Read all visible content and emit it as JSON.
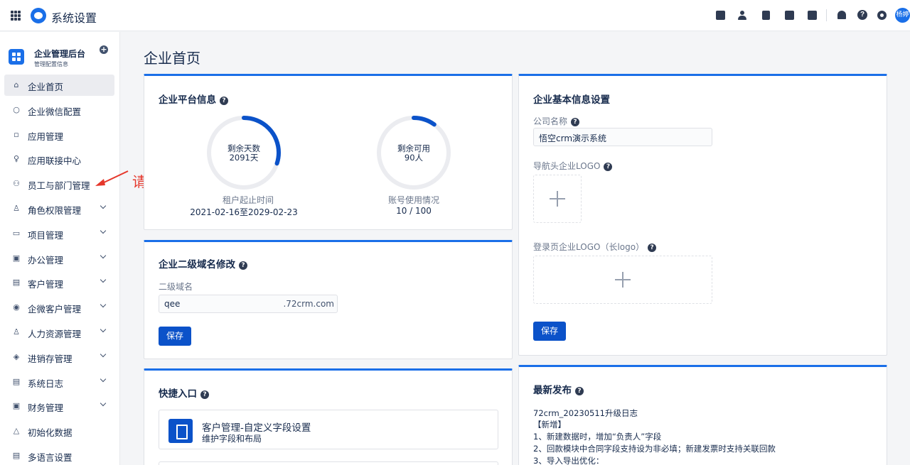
{
  "topbar": {
    "app_title": "系统设置",
    "icons": [
      "calendar-check-icon",
      "contacts-icon",
      "document-icon",
      "phone-icon",
      "calendar-icon",
      "bell-icon",
      "help-icon",
      "settings-icon"
    ],
    "avatar_text": "杨婷"
  },
  "sidebar": {
    "title": "企业管理后台",
    "subtitle": "管理配置信息",
    "items": [
      {
        "label": "企业首页",
        "icon": "home-icon",
        "expandable": false,
        "active": true
      },
      {
        "label": "企业微信配置",
        "icon": "search-icon",
        "expandable": false
      },
      {
        "label": "应用管理",
        "icon": "apps-icon",
        "expandable": false
      },
      {
        "label": "应用联接中心",
        "icon": "bulb-icon",
        "expandable": false
      },
      {
        "label": "员工与部门管理",
        "icon": "users-icon",
        "expandable": false
      },
      {
        "label": "角色权限管理",
        "icon": "role-icon",
        "expandable": true
      },
      {
        "label": "项目管理",
        "icon": "project-icon",
        "expandable": true
      },
      {
        "label": "办公管理",
        "icon": "office-icon",
        "expandable": true
      },
      {
        "label": "客户管理",
        "icon": "customer-icon",
        "expandable": true
      },
      {
        "label": "企微客户管理",
        "icon": "wecom-icon",
        "expandable": true
      },
      {
        "label": "人力资源管理",
        "icon": "hr-icon",
        "expandable": true
      },
      {
        "label": "进销存管理",
        "icon": "inventory-icon",
        "expandable": true
      },
      {
        "label": "系统日志",
        "icon": "log-icon",
        "expandable": true
      },
      {
        "label": "财务管理",
        "icon": "finance-icon",
        "expandable": true
      },
      {
        "label": "初始化数据",
        "icon": "init-icon",
        "expandable": false
      },
      {
        "label": "多语言设置",
        "icon": "language-icon",
        "expandable": false
      }
    ]
  },
  "annotation": {
    "text": "请单击此处",
    "color": "#e5372b"
  },
  "main": {
    "page_title": "企业首页",
    "platform": {
      "title": "企业平台信息",
      "days_label": "剩余天数",
      "days_value": "2091天",
      "days_fraction": 0.3,
      "period_caption": "租户起止时间",
      "period_value": "2021-02-16至2029-02-23",
      "accounts_label": "剩余可用",
      "accounts_value": "90人",
      "accounts_fraction": 0.1,
      "accounts_caption": "账号使用情况",
      "accounts_usage": "10 / 100"
    },
    "domain": {
      "title": "企业二级域名修改",
      "field_label": "二级域名",
      "value": "qee",
      "suffix": ".72crm.com",
      "save": "保存"
    },
    "basic": {
      "title": "企业基本信息设置",
      "company_label": "公司名称",
      "company_value": "悟空crm演示系统",
      "nav_logo_label": "导航头企业LOGO",
      "login_logo_label": "登录页企业LOGO（长logo）",
      "save": "保存"
    },
    "quick": {
      "title": "快捷入口",
      "item_title": "客户管理-自定义字段设置",
      "item_sub": "维护字段和布局"
    },
    "release": {
      "title": "最新发布",
      "lines": [
        "72crm_20230511升级日志",
        "【新增】",
        "1、新建数据时，增加“负责人”字段",
        "2、回款模块中合同字段支持设为非必填；新建发票时支持关联回款",
        "3、导入导出优化："
      ]
    }
  },
  "colors": {
    "accent": "#1a6fe8",
    "button": "#0b52c9",
    "ring_track": "#ebecf0"
  }
}
